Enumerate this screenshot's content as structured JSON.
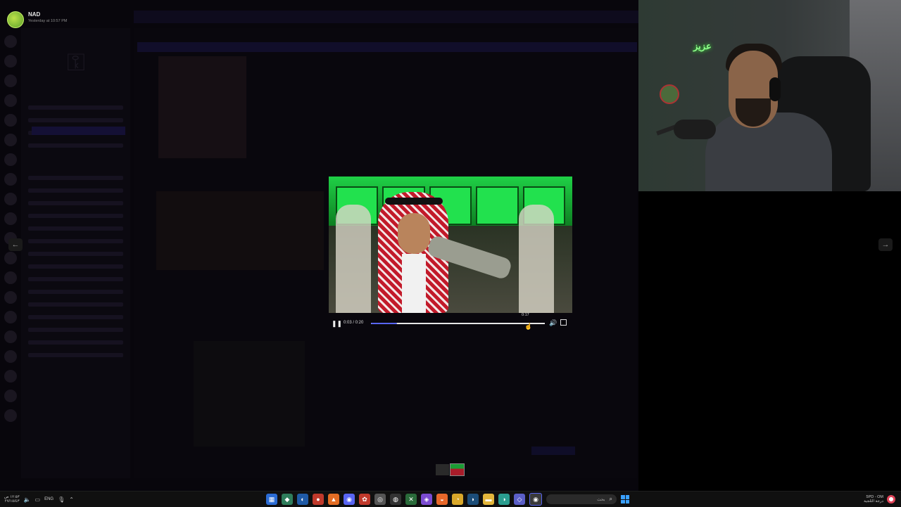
{
  "header": {
    "username": "NAD",
    "timestamp": "Yesterday at 10:57 PM"
  },
  "nav": {
    "prev_icon": "arrow-left-icon",
    "next_icon": "arrow-right-icon",
    "prev_glyph": "←",
    "next_glyph": "→"
  },
  "player": {
    "time_display": "0:03 / 0:20",
    "hover_time": "0:17",
    "progress_fraction": 0.15,
    "pause_glyph": "❚❚",
    "volume_glyph": "🔊",
    "accent_color": "#5865f2"
  },
  "webcam": {
    "neon_sign": "ﻋﺰﻳﺰ"
  },
  "taskbar": {
    "clock_time": "١٢:٥٣ ص",
    "clock_date": "٢٧/١٥/٤٣",
    "language": "ENG",
    "search_placeholder": "بحث",
    "weather_temp": "5PD - OM",
    "weather_desc": "درجة الثلجية",
    "apps": [
      "file-explorer",
      "store",
      "edge",
      "game",
      "brave",
      "discord",
      "settings",
      "photos",
      "obs",
      "nvidia",
      "xbox",
      "firefox",
      "chrome",
      "steam",
      "folder",
      "edge-dev",
      "teams",
      "discord-active"
    ]
  }
}
